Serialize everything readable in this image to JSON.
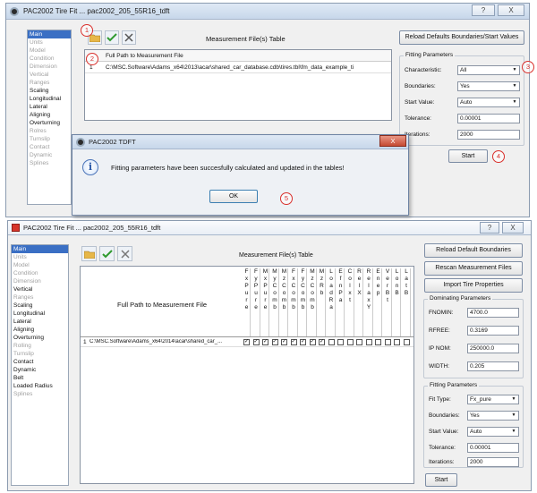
{
  "top": {
    "title": "PAC2002 Tire Fit ...  pac2002_205_55R16_tdft",
    "sidebar": [
      {
        "label": "Main",
        "state": "sel"
      },
      {
        "label": "Units",
        "state": "dis"
      },
      {
        "label": "Model",
        "state": "dis"
      },
      {
        "label": "Condition",
        "state": "dis"
      },
      {
        "label": "Dimension",
        "state": "dis"
      },
      {
        "label": "Vertical",
        "state": "dis"
      },
      {
        "label": "Ranges",
        "state": "dis"
      },
      {
        "label": "Scaling",
        "state": ""
      },
      {
        "label": "Longitudinal",
        "state": ""
      },
      {
        "label": "Lateral",
        "state": ""
      },
      {
        "label": "Aligning",
        "state": ""
      },
      {
        "label": "Overturning",
        "state": ""
      },
      {
        "label": "Rolres",
        "state": "dis"
      },
      {
        "label": "Turnslip",
        "state": "dis"
      },
      {
        "label": "Contact",
        "state": "dis"
      },
      {
        "label": "Dynamic",
        "state": "dis"
      },
      {
        "label": "Splines",
        "state": "dis"
      }
    ],
    "table_title": "Measurement File(s) Table",
    "reload_label": "Reload Defaults Boundaries/Start Values",
    "col_header": "Full Path to Measurement File",
    "row_num": "1",
    "row_path": "C:\\MSC.Software\\Adams_x64\\2013\\acar\\shared_car_database.cdb\\tires.tbl\\fm_data_example_ti",
    "fitting_title": "Fitting Parameters",
    "characteristic_label": "Characteristic:",
    "characteristic_value": "All",
    "boundaries_label": "Boundaries:",
    "boundaries_value": "Yes",
    "start_value_label": "Start Value:",
    "start_value_value": "Auto",
    "tolerance_label": "Tolerance:",
    "tolerance_value": "0.00001",
    "iterations_label": "Iterations:",
    "iterations_value": "2000",
    "start_label": "Start",
    "annotations": [
      "1",
      "2",
      "3",
      "4",
      "5"
    ]
  },
  "dialog": {
    "title": "PAC2002 TDFT",
    "message": "Fitting parameters have been succesfully calculated and updated in the tables!",
    "ok_label": "OK",
    "info_glyph": "i"
  },
  "bottom": {
    "title": "PAC2002 Tire Fit ...  pac2002_205_55R16_tdft",
    "sidebar": [
      {
        "label": "Main",
        "state": "sel"
      },
      {
        "label": "Units",
        "state": "dis"
      },
      {
        "label": "Model",
        "state": "dis"
      },
      {
        "label": "Condition",
        "state": "dis"
      },
      {
        "label": "Dimension",
        "state": "dis"
      },
      {
        "label": "Vertical",
        "state": ""
      },
      {
        "label": "Ranges",
        "state": "dis"
      },
      {
        "label": "Scaling",
        "state": ""
      },
      {
        "label": "Longitudinal",
        "state": ""
      },
      {
        "label": "Lateral",
        "state": ""
      },
      {
        "label": "Aligning",
        "state": ""
      },
      {
        "label": "Overturning",
        "state": ""
      },
      {
        "label": "Rolling",
        "state": "dis"
      },
      {
        "label": "Turnslip",
        "state": "dis"
      },
      {
        "label": "Contact",
        "state": ""
      },
      {
        "label": "Dynamic",
        "state": ""
      },
      {
        "label": "Belt",
        "state": ""
      },
      {
        "label": "Loaded Radius",
        "state": ""
      },
      {
        "label": "Splines",
        "state": "dis"
      }
    ],
    "table_title": "Measurement File(s) Table",
    "col_header": "Full Path to Measurement File",
    "columns": [
      [
        "F",
        "x",
        "",
        "P",
        "u",
        "r",
        "e"
      ],
      [
        "F",
        "y",
        "",
        "P",
        "u",
        "r",
        "e"
      ],
      [
        "M",
        "x",
        "",
        "P",
        "u",
        "r",
        "e"
      ],
      [
        "M",
        "y",
        "",
        "C",
        "o",
        "m",
        "b"
      ],
      [
        "M",
        "z",
        "",
        "C",
        "o",
        "m",
        "b"
      ],
      [
        "F",
        "x",
        "",
        "C",
        "o",
        "m",
        "b"
      ],
      [
        "F",
        "y",
        "",
        "C",
        "o",
        "m",
        "b"
      ],
      [
        "M",
        "z",
        "",
        "C",
        "o",
        "m",
        "b"
      ],
      [
        "M",
        "z",
        "",
        "R",
        "",
        "",
        "b"
      ],
      [
        "L",
        "o",
        "a",
        "d",
        "",
        "R",
        "a"
      ],
      [
        "E",
        "f",
        "n",
        "",
        "P",
        "",
        "a"
      ],
      [
        "C",
        "o",
        "l",
        "",
        "x",
        "",
        "t"
      ],
      [
        "R",
        "e",
        "l",
        "",
        "X",
        "",
        ""
      ],
      [
        "R",
        "e",
        "l",
        "a",
        "x",
        "",
        "Y"
      ],
      [
        "E",
        "n",
        "e",
        "",
        "",
        "",
        "p"
      ],
      [
        "V",
        "e",
        "r",
        "",
        "B",
        "",
        "t"
      ],
      [
        "L",
        "o",
        "n",
        "B",
        "",
        "",
        ""
      ],
      [
        "L",
        "a",
        "t",
        "B",
        "",
        "",
        ""
      ]
    ],
    "row_num": "1",
    "row_path": "C:\\MSC.Software\\Adams_x64\\2014\\acar\\shared_car_...",
    "checked": [
      true,
      true,
      true,
      true,
      true,
      true,
      true,
      true,
      true,
      false,
      false,
      false,
      false,
      false,
      false,
      false,
      false,
      false
    ],
    "reload_label": "Reload Default Boundaries",
    "rescan_label": "Rescan Measurement Files",
    "import_label": "Import Tire Properties",
    "dominating_title": "Dominating Parameters",
    "fnomin_label": "FNOMIN:",
    "fnomin_value": "4700.0",
    "rfree_label": "RFREE:",
    "rfree_value": "0.3169",
    "ipnom_label": "IP NOM:",
    "ipnom_value": "250000.0",
    "width_label": "WIDTH:",
    "width_value": "0.205",
    "fitting_title": "Fitting Parameters",
    "fit_type_label": "Fit Type:",
    "fit_type_value": "Fx_pure",
    "boundaries_label": "Boundaries:",
    "boundaries_value": "Yes",
    "start_value_label": "Start Value:",
    "start_value_value": "Auto",
    "tolerance_label": "Tolerance:",
    "tolerance_value": "0.00001",
    "iterations_label": "Iterations:",
    "iterations_value": "2000",
    "start_label": "Start"
  },
  "caption_buttons": {
    "help": "?",
    "close": "X"
  }
}
